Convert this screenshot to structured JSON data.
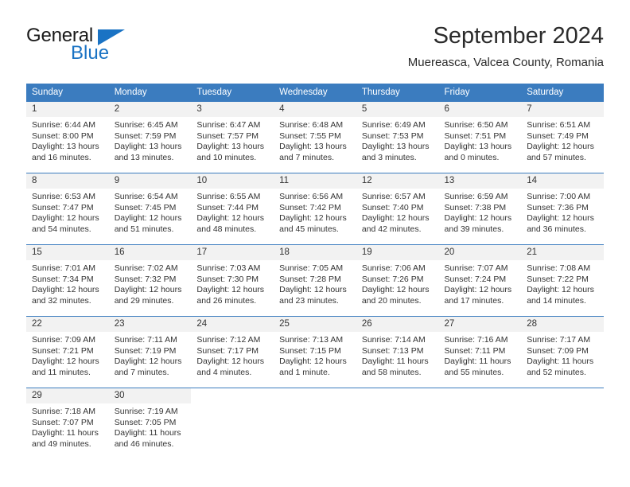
{
  "brand": {
    "name_part1": "General",
    "name_part2": "Blue",
    "accent_color": "#1a73c4"
  },
  "header": {
    "title": "September 2024",
    "subtitle": "Muereasca, Valcea County, Romania"
  },
  "calendar": {
    "header_bg": "#3b7cbf",
    "daynum_bg": "#f2f2f2",
    "weekday_headers": [
      "Sunday",
      "Monday",
      "Tuesday",
      "Wednesday",
      "Thursday",
      "Friday",
      "Saturday"
    ],
    "weeks": [
      [
        {
          "day": "1",
          "sunrise": "Sunrise: 6:44 AM",
          "sunset": "Sunset: 8:00 PM",
          "daylight_line1": "Daylight: 13 hours",
          "daylight_line2": "and 16 minutes."
        },
        {
          "day": "2",
          "sunrise": "Sunrise: 6:45 AM",
          "sunset": "Sunset: 7:59 PM",
          "daylight_line1": "Daylight: 13 hours",
          "daylight_line2": "and 13 minutes."
        },
        {
          "day": "3",
          "sunrise": "Sunrise: 6:47 AM",
          "sunset": "Sunset: 7:57 PM",
          "daylight_line1": "Daylight: 13 hours",
          "daylight_line2": "and 10 minutes."
        },
        {
          "day": "4",
          "sunrise": "Sunrise: 6:48 AM",
          "sunset": "Sunset: 7:55 PM",
          "daylight_line1": "Daylight: 13 hours",
          "daylight_line2": "and 7 minutes."
        },
        {
          "day": "5",
          "sunrise": "Sunrise: 6:49 AM",
          "sunset": "Sunset: 7:53 PM",
          "daylight_line1": "Daylight: 13 hours",
          "daylight_line2": "and 3 minutes."
        },
        {
          "day": "6",
          "sunrise": "Sunrise: 6:50 AM",
          "sunset": "Sunset: 7:51 PM",
          "daylight_line1": "Daylight: 13 hours",
          "daylight_line2": "and 0 minutes."
        },
        {
          "day": "7",
          "sunrise": "Sunrise: 6:51 AM",
          "sunset": "Sunset: 7:49 PM",
          "daylight_line1": "Daylight: 12 hours",
          "daylight_line2": "and 57 minutes."
        }
      ],
      [
        {
          "day": "8",
          "sunrise": "Sunrise: 6:53 AM",
          "sunset": "Sunset: 7:47 PM",
          "daylight_line1": "Daylight: 12 hours",
          "daylight_line2": "and 54 minutes."
        },
        {
          "day": "9",
          "sunrise": "Sunrise: 6:54 AM",
          "sunset": "Sunset: 7:45 PM",
          "daylight_line1": "Daylight: 12 hours",
          "daylight_line2": "and 51 minutes."
        },
        {
          "day": "10",
          "sunrise": "Sunrise: 6:55 AM",
          "sunset": "Sunset: 7:44 PM",
          "daylight_line1": "Daylight: 12 hours",
          "daylight_line2": "and 48 minutes."
        },
        {
          "day": "11",
          "sunrise": "Sunrise: 6:56 AM",
          "sunset": "Sunset: 7:42 PM",
          "daylight_line1": "Daylight: 12 hours",
          "daylight_line2": "and 45 minutes."
        },
        {
          "day": "12",
          "sunrise": "Sunrise: 6:57 AM",
          "sunset": "Sunset: 7:40 PM",
          "daylight_line1": "Daylight: 12 hours",
          "daylight_line2": "and 42 minutes."
        },
        {
          "day": "13",
          "sunrise": "Sunrise: 6:59 AM",
          "sunset": "Sunset: 7:38 PM",
          "daylight_line1": "Daylight: 12 hours",
          "daylight_line2": "and 39 minutes."
        },
        {
          "day": "14",
          "sunrise": "Sunrise: 7:00 AM",
          "sunset": "Sunset: 7:36 PM",
          "daylight_line1": "Daylight: 12 hours",
          "daylight_line2": "and 36 minutes."
        }
      ],
      [
        {
          "day": "15",
          "sunrise": "Sunrise: 7:01 AM",
          "sunset": "Sunset: 7:34 PM",
          "daylight_line1": "Daylight: 12 hours",
          "daylight_line2": "and 32 minutes."
        },
        {
          "day": "16",
          "sunrise": "Sunrise: 7:02 AM",
          "sunset": "Sunset: 7:32 PM",
          "daylight_line1": "Daylight: 12 hours",
          "daylight_line2": "and 29 minutes."
        },
        {
          "day": "17",
          "sunrise": "Sunrise: 7:03 AM",
          "sunset": "Sunset: 7:30 PM",
          "daylight_line1": "Daylight: 12 hours",
          "daylight_line2": "and 26 minutes."
        },
        {
          "day": "18",
          "sunrise": "Sunrise: 7:05 AM",
          "sunset": "Sunset: 7:28 PM",
          "daylight_line1": "Daylight: 12 hours",
          "daylight_line2": "and 23 minutes."
        },
        {
          "day": "19",
          "sunrise": "Sunrise: 7:06 AM",
          "sunset": "Sunset: 7:26 PM",
          "daylight_line1": "Daylight: 12 hours",
          "daylight_line2": "and 20 minutes."
        },
        {
          "day": "20",
          "sunrise": "Sunrise: 7:07 AM",
          "sunset": "Sunset: 7:24 PM",
          "daylight_line1": "Daylight: 12 hours",
          "daylight_line2": "and 17 minutes."
        },
        {
          "day": "21",
          "sunrise": "Sunrise: 7:08 AM",
          "sunset": "Sunset: 7:22 PM",
          "daylight_line1": "Daylight: 12 hours",
          "daylight_line2": "and 14 minutes."
        }
      ],
      [
        {
          "day": "22",
          "sunrise": "Sunrise: 7:09 AM",
          "sunset": "Sunset: 7:21 PM",
          "daylight_line1": "Daylight: 12 hours",
          "daylight_line2": "and 11 minutes."
        },
        {
          "day": "23",
          "sunrise": "Sunrise: 7:11 AM",
          "sunset": "Sunset: 7:19 PM",
          "daylight_line1": "Daylight: 12 hours",
          "daylight_line2": "and 7 minutes."
        },
        {
          "day": "24",
          "sunrise": "Sunrise: 7:12 AM",
          "sunset": "Sunset: 7:17 PM",
          "daylight_line1": "Daylight: 12 hours",
          "daylight_line2": "and 4 minutes."
        },
        {
          "day": "25",
          "sunrise": "Sunrise: 7:13 AM",
          "sunset": "Sunset: 7:15 PM",
          "daylight_line1": "Daylight: 12 hours",
          "daylight_line2": "and 1 minute."
        },
        {
          "day": "26",
          "sunrise": "Sunrise: 7:14 AM",
          "sunset": "Sunset: 7:13 PM",
          "daylight_line1": "Daylight: 11 hours",
          "daylight_line2": "and 58 minutes."
        },
        {
          "day": "27",
          "sunrise": "Sunrise: 7:16 AM",
          "sunset": "Sunset: 7:11 PM",
          "daylight_line1": "Daylight: 11 hours",
          "daylight_line2": "and 55 minutes."
        },
        {
          "day": "28",
          "sunrise": "Sunrise: 7:17 AM",
          "sunset": "Sunset: 7:09 PM",
          "daylight_line1": "Daylight: 11 hours",
          "daylight_line2": "and 52 minutes."
        }
      ],
      [
        {
          "day": "29",
          "sunrise": "Sunrise: 7:18 AM",
          "sunset": "Sunset: 7:07 PM",
          "daylight_line1": "Daylight: 11 hours",
          "daylight_line2": "and 49 minutes."
        },
        {
          "day": "30",
          "sunrise": "Sunrise: 7:19 AM",
          "sunset": "Sunset: 7:05 PM",
          "daylight_line1": "Daylight: 11 hours",
          "daylight_line2": "and 46 minutes."
        },
        null,
        null,
        null,
        null,
        null
      ]
    ]
  }
}
